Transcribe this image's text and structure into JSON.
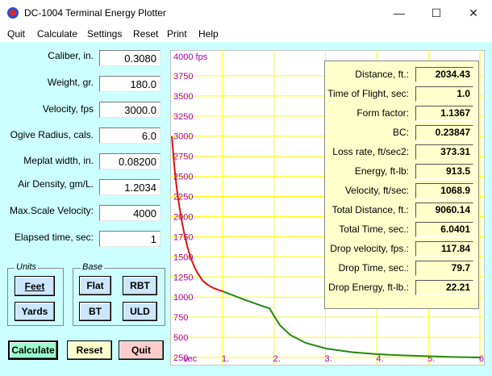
{
  "window": {
    "title": "DC-1004 Terminal Energy Plotter",
    "minimize_glyph": "—",
    "maximize_glyph": "☐",
    "close_glyph": "✕"
  },
  "menu": [
    "Quit",
    "Calculate",
    "Settings",
    "Reset",
    "Print",
    "Help"
  ],
  "params": [
    {
      "label": "Caliber, in.",
      "value": "0.3080"
    },
    {
      "label": "Weight, gr.",
      "value": "180.0"
    },
    {
      "label": "Velocity, fps",
      "value": "3000.0"
    },
    {
      "label": "Ogive Radius, cals.",
      "value": "6.0"
    },
    {
      "label": "Meplat width, in.",
      "value": "0.08200"
    },
    {
      "label": "Air Density, gm/L.",
      "value": "1.2034"
    },
    {
      "label": "Max.Scale Velocity:",
      "value": "4000"
    },
    {
      "label": "Elapsed time, sec:",
      "value": "1"
    }
  ],
  "units": {
    "title": "Units",
    "feet": "Feet",
    "yards": "Yards"
  },
  "base": {
    "title": "Base",
    "flat": "Flat",
    "rbt": "RBT",
    "bt": "BT",
    "uld": "ULD"
  },
  "actions": {
    "calculate": "Calculate",
    "reset": "Reset",
    "quit": "Quit"
  },
  "results": [
    {
      "label": "Distance, ft.:",
      "value": "2034.43"
    },
    {
      "label": "Time of Flight, sec:",
      "value": "1.0"
    },
    {
      "label": "Form factor:",
      "value": "1.1367"
    },
    {
      "label": "BC:",
      "value": "0.23847"
    },
    {
      "label": "Loss rate, ft/sec2:",
      "value": "373.31"
    },
    {
      "label": "Energy, ft-lb:",
      "value": "913.5"
    },
    {
      "label": "Velocity, ft/sec:",
      "value": "1068.9"
    },
    {
      "label": "Total Distance, ft.:",
      "value": "9060.14"
    },
    {
      "label": "Total Time, sec.:",
      "value": "6.0401"
    },
    {
      "label": "Drop velocity, fps.:",
      "value": "117.84"
    },
    {
      "label": "Drop Time, sec.:",
      "value": "79.7"
    },
    {
      "label": "Drop Energy, ft-lb.:",
      "value": "22.21"
    }
  ],
  "colors": {
    "client_bg": "#ccffff",
    "grid": "#ffff00",
    "axis_text": "#aa00aa",
    "curve_red": "#dd1111",
    "curve_green": "#228811"
  },
  "chart_data": {
    "type": "line",
    "y_tick_labels": [
      "4000 fps",
      "3750",
      "3500",
      "3250",
      "3000",
      "2750",
      "2500",
      "2250",
      "2000",
      "1750",
      "1500",
      "1250",
      "1000",
      "750",
      "500",
      "250"
    ],
    "y_tick_values": [
      4000,
      3750,
      3500,
      3250,
      3000,
      2750,
      2500,
      2250,
      2000,
      1750,
      1500,
      1250,
      1000,
      750,
      500,
      250
    ],
    "x_tick_labels": [
      "sec",
      "1.",
      "2.",
      "3.",
      "4.",
      "5.",
      "6."
    ],
    "xlim": [
      0,
      6
    ],
    "ylim": [
      250,
      4000
    ],
    "grid": true,
    "series": [
      {
        "color": "#dd1111",
        "x": [
          0,
          0.05,
          0.1,
          0.15,
          0.2,
          0.25,
          0.3,
          0.35,
          0.4,
          0.45,
          0.5,
          0.6,
          0.7,
          0.8,
          0.9,
          1.0
        ],
        "y": [
          3000,
          2620,
          2330,
          2110,
          1920,
          1765,
          1635,
          1525,
          1435,
          1360,
          1300,
          1205,
          1150,
          1115,
          1090,
          1069
        ]
      },
      {
        "color": "#228811",
        "x": [
          1.0,
          1.2,
          1.4,
          1.6,
          1.8,
          1.9,
          2.0,
          2.1,
          2.3,
          2.6,
          3.0,
          3.5,
          4.0,
          4.5,
          5.0,
          5.5,
          6.0
        ],
        "y": [
          1069,
          1020,
          970,
          925,
          880,
          860,
          750,
          650,
          530,
          430,
          360,
          315,
          290,
          275,
          265,
          255,
          250
        ]
      }
    ]
  }
}
